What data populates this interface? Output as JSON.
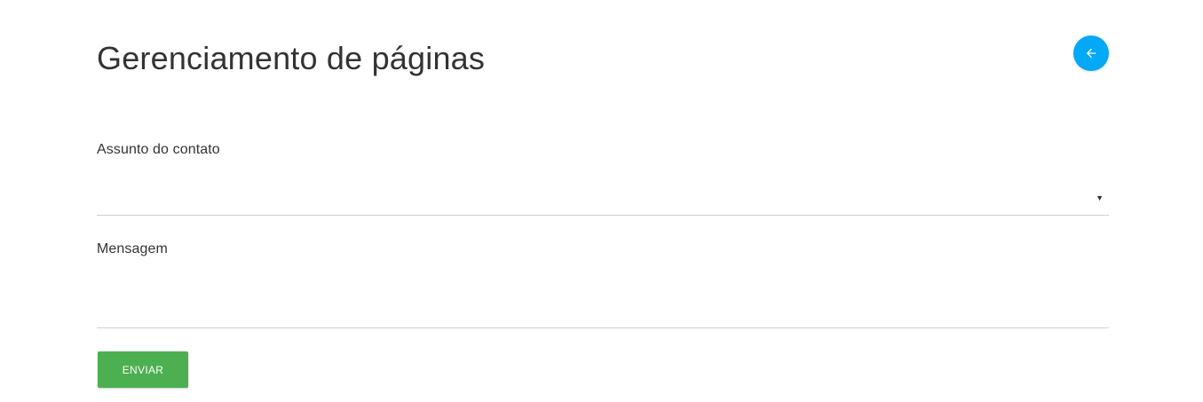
{
  "page": {
    "title": "Gerenciamento de páginas"
  },
  "header": {
    "back_button_icon": "arrow-left-icon",
    "back_button_color": "#03a9f4"
  },
  "form": {
    "subject": {
      "label": "Assunto do contato",
      "selected_value": "",
      "caret_icon": "caret-down-icon"
    },
    "message": {
      "label": "Mensagem",
      "value": "",
      "placeholder": ""
    },
    "submit": {
      "label": "ENVIAR",
      "color": "#4caf50"
    }
  }
}
